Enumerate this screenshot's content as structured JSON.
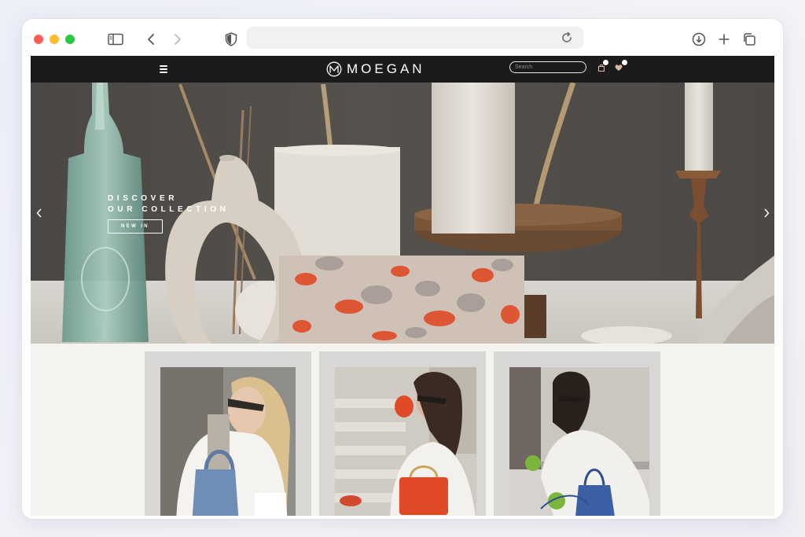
{
  "browser": {
    "address_value": "",
    "icons": [
      "sidebar-icon",
      "back-icon",
      "forward-icon",
      "shield-icon",
      "reload-icon",
      "download-icon",
      "new-tab-icon",
      "tabs-icon"
    ]
  },
  "site": {
    "brand": "MOEGAN",
    "search_placeholder": "Search",
    "icons": [
      "menu-icon",
      "bag-icon",
      "heart-icon"
    ]
  },
  "hero": {
    "line1": "DISCOVER",
    "line2": "OUR COLLECTION",
    "button_label": "NEW IN",
    "arrows": [
      "chevron-left-icon",
      "chevron-right-icon"
    ]
  },
  "products": [
    {
      "name": "product-photo-denim-bag"
    },
    {
      "name": "product-photo-red-bag"
    },
    {
      "name": "product-photo-blue-bucket-bag"
    }
  ],
  "colors": {
    "nav_bg": "#1c1b1b",
    "page_bg": "#f4f3ef",
    "card_bg": "#d8d7d6",
    "accent_red": "#e04a26"
  }
}
